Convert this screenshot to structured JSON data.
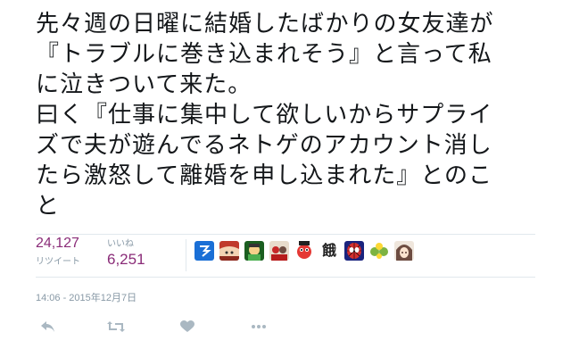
{
  "tweet": {
    "lines": [
      "先々週の日曜に結婚したばかりの女友達が",
      "『トラブルに巻き込まれそう』と言って私",
      "に泣きついて来た。",
      "曰く『仕事に集中して欲しいからサプライ",
      "ズで夫が遊んでるネトゲのアカウント消し",
      "たら激怒して離婚を申し込まれた』とのこ",
      "と"
    ]
  },
  "stats": {
    "retweets": {
      "count": "24,127",
      "label": "リツイート"
    },
    "likes": {
      "count": "6,251",
      "label": "いいね"
    }
  },
  "avatars": [
    {
      "icon": "avatar-blue-logo",
      "color": "#1a6fd6"
    },
    {
      "icon": "avatar-anime-red",
      "color": "#c0392b"
    },
    {
      "icon": "avatar-green-character",
      "color": "#2e7d32"
    },
    {
      "icon": "avatar-red-group",
      "color": "#b71c1c"
    },
    {
      "icon": "avatar-mascot-pink",
      "color": "#e91e63"
    },
    {
      "icon": "avatar-kanji",
      "text": "餓"
    },
    {
      "icon": "avatar-spiderman",
      "color": "#d32f2f"
    },
    {
      "icon": "avatar-green-yellow-pattern",
      "color": "#7cb342"
    },
    {
      "icon": "avatar-anime-brown",
      "color": "#8d6e63"
    }
  ],
  "timestamp": "14:06 - 2015年12月7日",
  "actions": {
    "reply": "reply-icon",
    "retweet": "retweet-icon",
    "like": "heart-icon",
    "more": "more-icon"
  },
  "colors": {
    "accent_count": "#8a2c78",
    "muted": "#8899a6",
    "divider": "#e1e8ed"
  }
}
